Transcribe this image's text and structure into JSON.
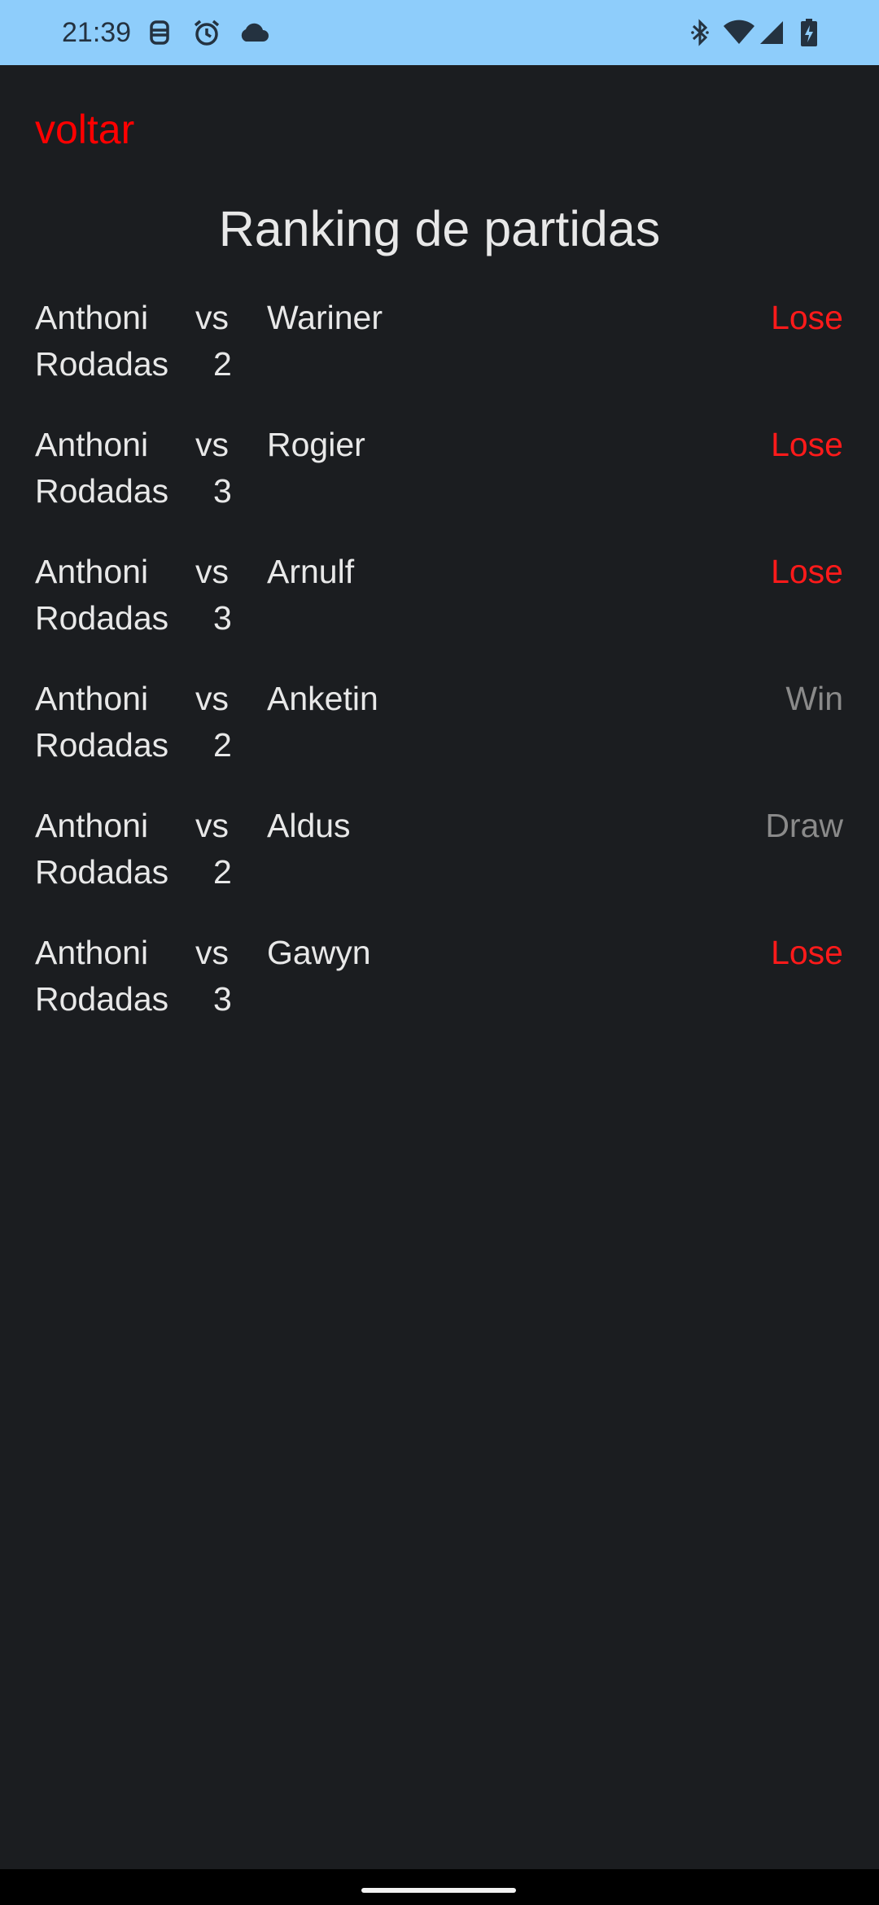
{
  "status_bar": {
    "time": "21:39",
    "icons": [
      "assistant-icon",
      "alarm-icon",
      "cloud-icon",
      "bluetooth-icon",
      "wifi-icon",
      "cell-signal-icon",
      "battery-charging-icon"
    ],
    "background": "#8ecdfb"
  },
  "header": {
    "back_label": "voltar",
    "title": "Ranking de partidas"
  },
  "colors": {
    "background": "#1b1d20",
    "text": "#e8e8e8",
    "lose": "#ff1a1a",
    "neutral": "#8a8a8a",
    "back_link": "#ff0000"
  },
  "matches": [
    {
      "player": "Anthoni",
      "vs": "vs",
      "opponent": "Wariner",
      "rounds_label": "Rodadas",
      "rounds": "2",
      "result": "Lose"
    },
    {
      "player": "Anthoni",
      "vs": "vs",
      "opponent": "Rogier",
      "rounds_label": "Rodadas",
      "rounds": "3",
      "result": "Lose"
    },
    {
      "player": "Anthoni",
      "vs": "vs",
      "opponent": "Arnulf",
      "rounds_label": "Rodadas",
      "rounds": "3",
      "result": "Lose"
    },
    {
      "player": "Anthoni",
      "vs": "vs",
      "opponent": "Anketin",
      "rounds_label": "Rodadas",
      "rounds": "2",
      "result": "Win"
    },
    {
      "player": "Anthoni",
      "vs": "vs",
      "opponent": "Aldus",
      "rounds_label": "Rodadas",
      "rounds": "2",
      "result": "Draw"
    },
    {
      "player": "Anthoni",
      "vs": "vs",
      "opponent": "Gawyn",
      "rounds_label": "Rodadas",
      "rounds": "3",
      "result": "Lose"
    }
  ]
}
